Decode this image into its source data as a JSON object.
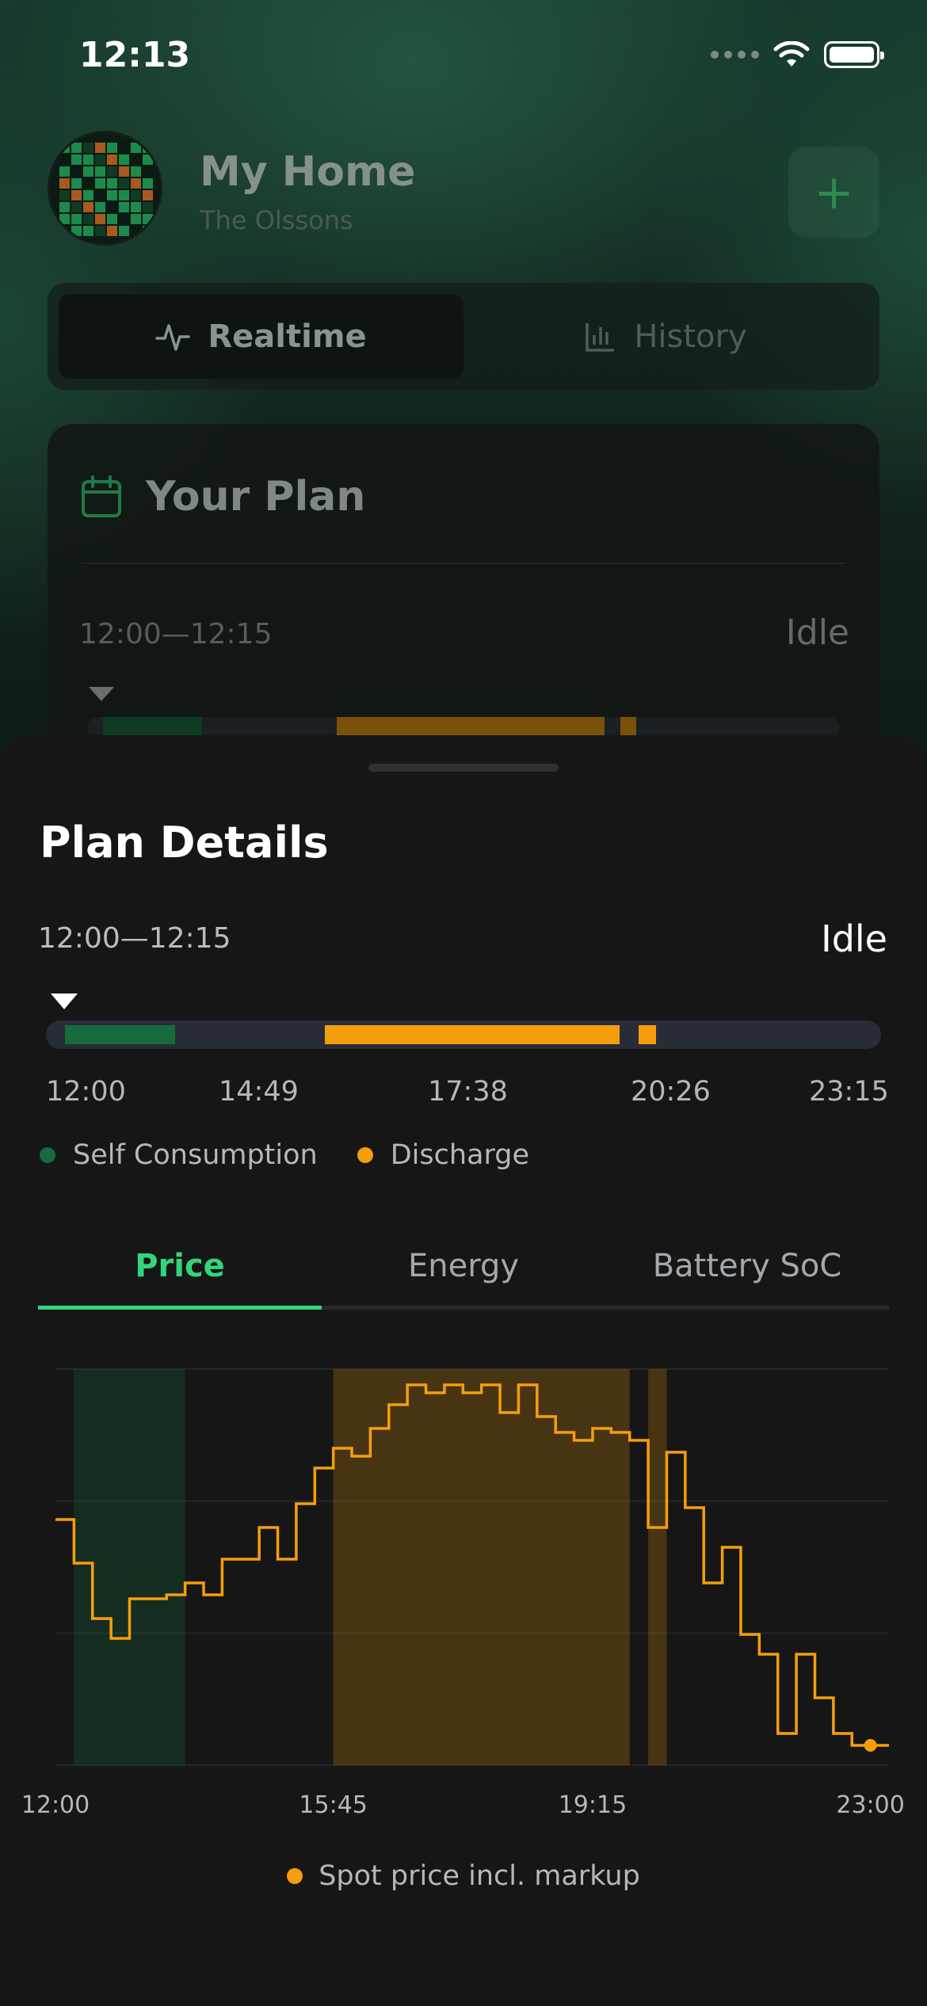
{
  "status_bar": {
    "time": "12:13"
  },
  "home": {
    "title": "My Home",
    "subtitle": "The Olssons",
    "add_label": "+"
  },
  "view_toggle": {
    "items": [
      {
        "label": "Realtime",
        "icon": "activity-icon",
        "active": true
      },
      {
        "label": "History",
        "icon": "bar-chart-icon",
        "active": false
      }
    ]
  },
  "plan_card": {
    "title": "Your Plan",
    "time_range": "12:00—12:15",
    "status": "Idle"
  },
  "plan_details": {
    "title": "Plan Details",
    "time_range": "12:00—12:15",
    "status": "Idle",
    "schedule": {
      "start": "12:00",
      "end": "23:15",
      "segments": [
        {
          "type": "Self Consumption",
          "from": "12:15",
          "to": "13:45"
        },
        {
          "type": "Discharge",
          "from": "15:45",
          "to": "19:45"
        },
        {
          "type": "Discharge",
          "from": "20:00",
          "to": "20:15"
        }
      ]
    },
    "tick_labels": [
      "12:00",
      "14:49",
      "17:38",
      "20:26",
      "23:15"
    ],
    "legend": [
      {
        "label": "Self Consumption",
        "color": "#176a3e"
      },
      {
        "label": "Discharge",
        "color": "#f59e0b"
      }
    ],
    "tabs": [
      {
        "label": "Price",
        "active": true
      },
      {
        "label": "Energy",
        "active": false
      },
      {
        "label": "Battery SoC",
        "active": false
      }
    ],
    "chart_legend": "Spot price incl. markup"
  },
  "colors": {
    "accent_green": "#34d57a",
    "discharge_orange": "#f59e0b",
    "self_consumption_green": "#176a3e"
  },
  "chart_data": {
    "type": "line",
    "step": "post",
    "x_tick_labels": [
      "12:00",
      "15:45",
      "19:15",
      "23:00"
    ],
    "x_range_hours": [
      12.0,
      23.25
    ],
    "ylim": [
      0,
      100
    ],
    "series": [
      {
        "name": "Spot price incl. markup",
        "color": "#f59e0b",
        "x_hours": [
          12.0,
          12.25,
          12.5,
          12.75,
          13.0,
          13.25,
          13.5,
          13.75,
          14.0,
          14.25,
          14.5,
          14.75,
          15.0,
          15.25,
          15.5,
          15.75,
          16.0,
          16.25,
          16.5,
          16.75,
          17.0,
          17.25,
          17.5,
          17.75,
          18.0,
          18.25,
          18.5,
          18.75,
          19.0,
          19.25,
          19.5,
          19.75,
          20.0,
          20.25,
          20.5,
          20.75,
          21.0,
          21.25,
          21.5,
          21.75,
          22.0,
          22.25,
          22.5,
          22.75,
          23.0,
          23.25
        ],
        "values": [
          62,
          51,
          37,
          32,
          42,
          42,
          43,
          46,
          43,
          52,
          52,
          60,
          52,
          66,
          75,
          80,
          78,
          85,
          91,
          96,
          94,
          96,
          94,
          96,
          89,
          96,
          88,
          84,
          82,
          85,
          84,
          82,
          60,
          79,
          65,
          46,
          55,
          33,
          28,
          8,
          28,
          17,
          8,
          5,
          5,
          5
        ],
        "current_marker_hours": 23.0
      }
    ],
    "highlight_regions": [
      {
        "type": "Self Consumption",
        "from_hours": 12.25,
        "to_hours": 13.75
      },
      {
        "type": "Discharge",
        "from_hours": 15.75,
        "to_hours": 19.75
      },
      {
        "type": "Discharge",
        "from_hours": 20.0,
        "to_hours": 20.25
      }
    ],
    "grid": true
  }
}
